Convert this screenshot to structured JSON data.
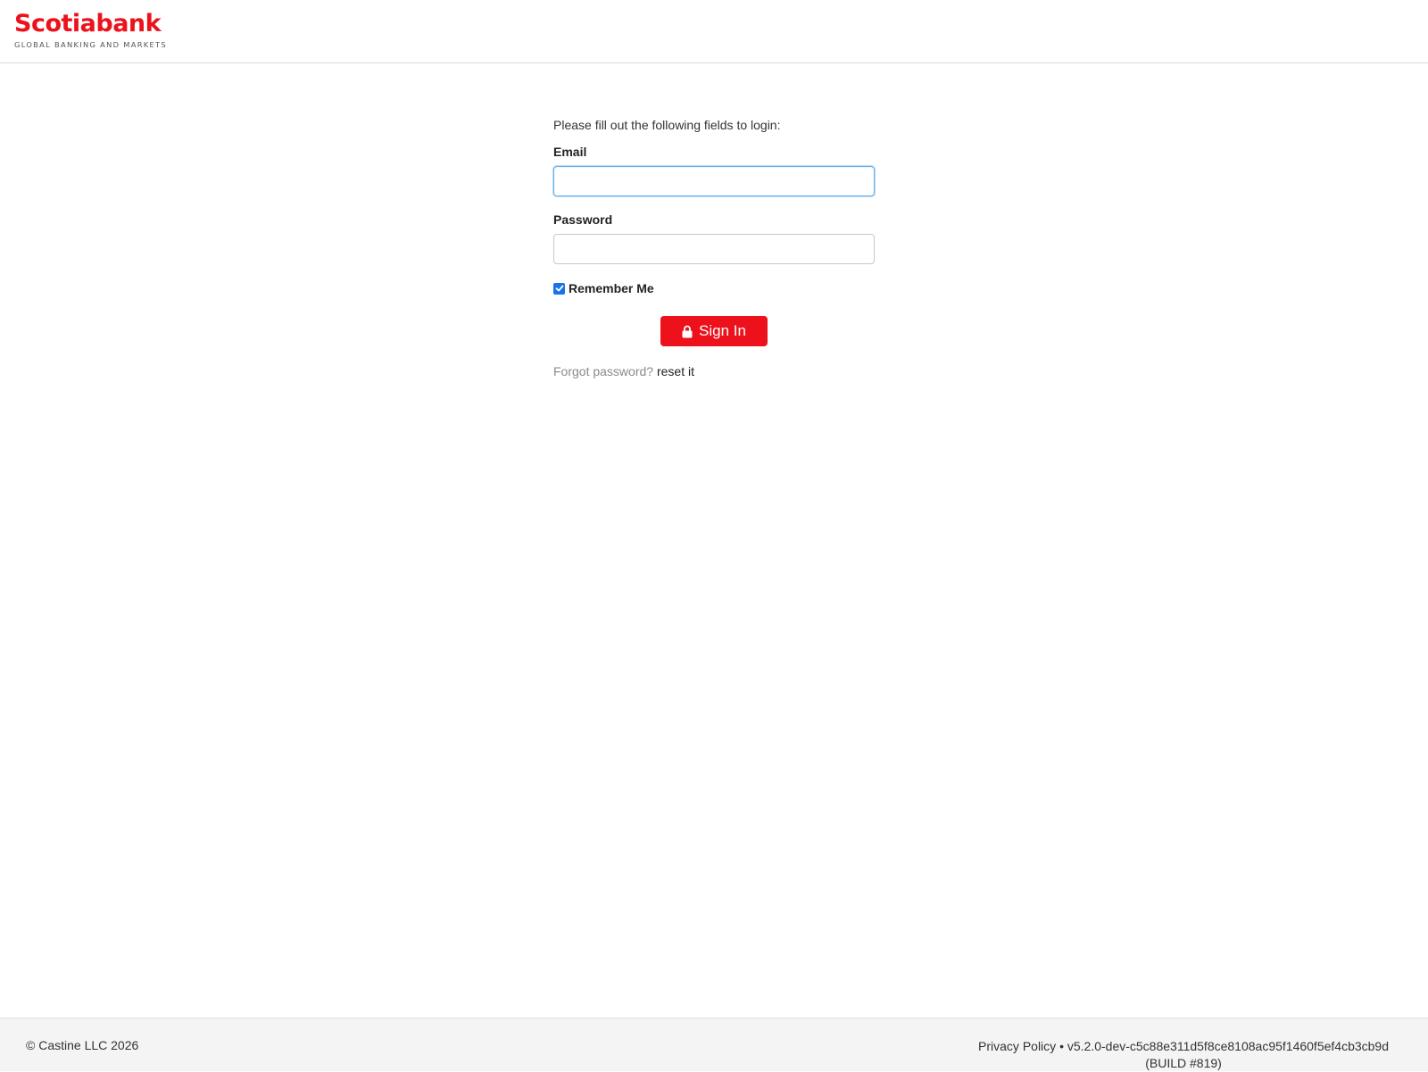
{
  "header": {
    "logo": {
      "name": "Scotiabank",
      "tagline": "GLOBAL BANKING AND MARKETS"
    }
  },
  "form": {
    "intro": "Please fill out the following fields to login:",
    "email": {
      "label": "Email",
      "value": "",
      "placeholder": ""
    },
    "password": {
      "label": "Password",
      "value": "",
      "placeholder": ""
    },
    "remember_me": {
      "label": "Remember Me",
      "checked": true
    },
    "signin": {
      "label": "Sign In",
      "icon": "lock-icon"
    },
    "forgot": {
      "text": "Forgot password?",
      "link": "reset it"
    }
  },
  "footer": {
    "copyright": "© Castine LLC 2026",
    "privacy": "Privacy Policy",
    "separator": "•",
    "version": "v5.2.0-dev-c5c88e311d5f8ce8108ac95f1460f5ef4cb3cb9d",
    "build": "(BUILD #819)"
  },
  "colors": {
    "brand": "#ec111a",
    "focus": "#66afe9",
    "checkbox": "#1a73e8"
  }
}
